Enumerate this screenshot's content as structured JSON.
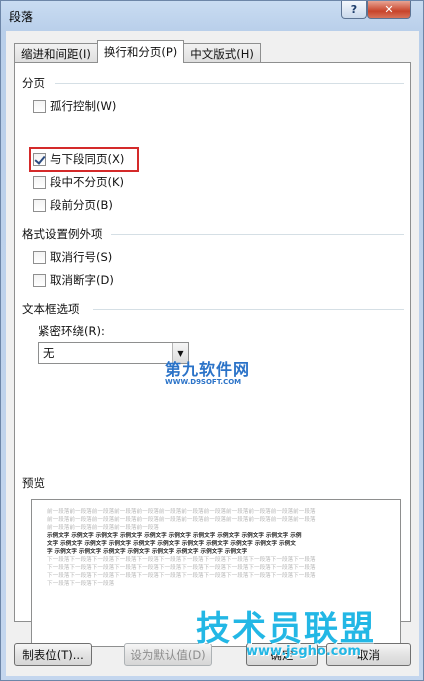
{
  "window": {
    "title": "段落"
  },
  "titlebar": {
    "help_label": "?",
    "close_label": "✕"
  },
  "tabs": [
    {
      "label": "缩进和间距(I)"
    },
    {
      "label": "换行和分页(P)"
    },
    {
      "label": "中文版式(H)"
    }
  ],
  "pagination": {
    "title": "分页",
    "items": [
      {
        "label": "孤行控制(W)",
        "checked": false
      },
      {
        "label": "与下段同页(X)",
        "checked": true
      },
      {
        "label": "段中不分页(K)",
        "checked": false
      },
      {
        "label": "段前分页(B)",
        "checked": false
      }
    ]
  },
  "format_exceptions": {
    "title": "格式设置例外项",
    "items": [
      {
        "label": "取消行号(S)",
        "checked": false
      },
      {
        "label": "取消断字(D)",
        "checked": false
      }
    ]
  },
  "textbox": {
    "title": "文本框选项",
    "wrap_label": "紧密环绕(R):",
    "wrap_value": "无"
  },
  "logo": {
    "main": "第九软件网",
    "sub": "WWW.D9SOFT.COM"
  },
  "preview": {
    "title": "预览",
    "before_lines": [
      "前一段落前一段落前一段落前一段落前一段落前一段落前一段落前一段落前一段落前一段落前一段落前一段落",
      "前一段落前一段落前一段落前一段落前一段落前一段落前一段落前一段落前一段落前一段落前一段落前一段落",
      "前一段落前一段落前一段落前一段落前一段落"
    ],
    "sample_lines": [
      "示例文字 示例文字 示例文字 示例文字 示例文字 示例文字 示例文字 示例文字 示例文字 示例文字 示例",
      "文字 示例文字 示例文字 示例文字 示例文字 示例文字 示例文字 示例文字 示例文字 示例文字 示例文",
      "字 示例文字 示例文字 示例文字 示例文字 示例文字 示例文字 示例文字 示例文字"
    ],
    "after_lines": [
      "下一段落下一段落下一段落下一段落下一段落下一段落下一段落下一段落下一段落下一段落下一段落下一段落",
      "下一段落下一段落下一段落下一段落下一段落下一段落下一段落下一段落下一段落下一段落下一段落下一段落",
      "下一段落下一段落下一段落下一段落下一段落下一段落下一段落下一段落下一段落下一段落下一段落下一段落",
      "下一段落下一段落下一段落"
    ]
  },
  "buttons": {
    "tabs_label": "制表位(T)...",
    "default_label": "设为默认值(D)",
    "ok_label": "确定",
    "cancel_label": "取消"
  },
  "watermark": {
    "main": "技术员联盟",
    "sub": "www.jsgho.com"
  }
}
